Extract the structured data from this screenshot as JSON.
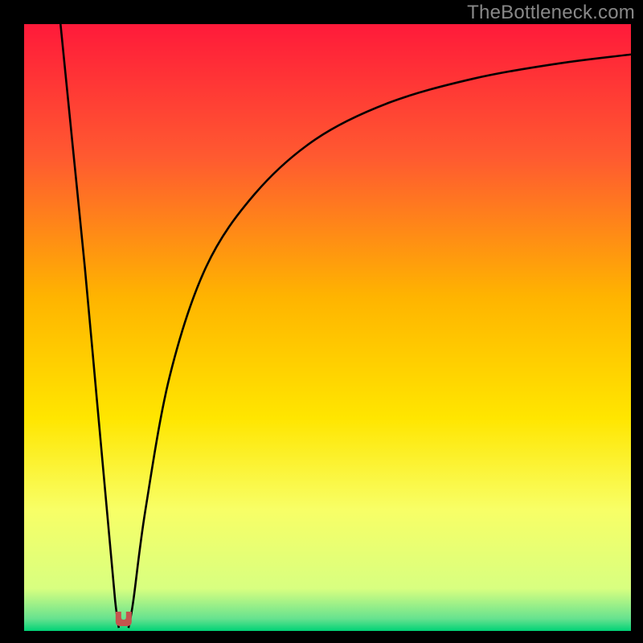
{
  "watermark": "TheBottleneck.com",
  "chart_data": {
    "type": "line",
    "title": "",
    "xlabel": "",
    "ylabel": "",
    "xlim": [
      0,
      100
    ],
    "ylim": [
      0,
      100
    ],
    "gradient_stops": [
      {
        "offset": 0.0,
        "color": "#ff1a3a"
      },
      {
        "offset": 0.22,
        "color": "#ff5a30"
      },
      {
        "offset": 0.45,
        "color": "#ffb400"
      },
      {
        "offset": 0.65,
        "color": "#ffe600"
      },
      {
        "offset": 0.8,
        "color": "#f8ff66"
      },
      {
        "offset": 0.93,
        "color": "#d8ff80"
      },
      {
        "offset": 0.98,
        "color": "#66e28f"
      },
      {
        "offset": 1.0,
        "color": "#00d276"
      }
    ],
    "series": [
      {
        "name": "left-branch",
        "x": [
          6.0,
          8.0,
          10.0,
          12.0,
          14.0,
          15.0,
          15.6
        ],
        "y": [
          100.0,
          80.0,
          60.0,
          38.0,
          16.0,
          5.0,
          0.5
        ]
      },
      {
        "name": "right-branch",
        "x": [
          17.2,
          18.0,
          20.0,
          24.0,
          30.0,
          38.0,
          48.0,
          60.0,
          74.0,
          88.0,
          100.0
        ],
        "y": [
          0.5,
          5.0,
          20.0,
          42.0,
          60.0,
          72.0,
          81.0,
          87.0,
          91.0,
          93.5,
          95.0
        ]
      }
    ],
    "marker": {
      "name": "u-marker",
      "cx": 16.4,
      "cy": 0.8,
      "color": "#c4544e"
    }
  }
}
